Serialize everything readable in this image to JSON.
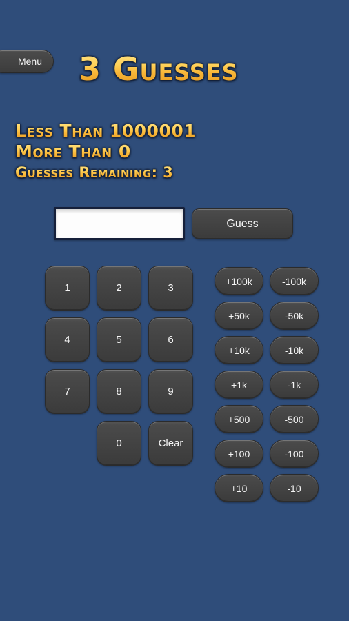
{
  "app": {
    "background_color": "#2F4D7A",
    "title": "3 Guesses"
  },
  "header": {
    "menu_label": "Menu",
    "title": "3 Guesses"
  },
  "status": {
    "less_than": "Less Than 1000001",
    "more_than": "More Than 0",
    "guesses_remaining": "Guesses Remaining: 3"
  },
  "guess_form": {
    "input_value": "",
    "input_placeholder": "",
    "submit_label": "Guess"
  },
  "keypad": {
    "keys": [
      {
        "label": "1",
        "name": "key-1"
      },
      {
        "label": "2",
        "name": "key-2"
      },
      {
        "label": "3",
        "name": "key-3"
      },
      {
        "label": "4",
        "name": "key-4"
      },
      {
        "label": "5",
        "name": "key-5"
      },
      {
        "label": "6",
        "name": "key-6"
      },
      {
        "label": "7",
        "name": "key-7"
      },
      {
        "label": "8",
        "name": "key-8"
      },
      {
        "label": "9",
        "name": "key-9"
      },
      {
        "label": "",
        "name": "key-blank"
      },
      {
        "label": "0",
        "name": "key-0"
      },
      {
        "label": "Clear",
        "name": "key-clear"
      }
    ]
  },
  "adjust_pad": {
    "rows": [
      {
        "increase": "+100k",
        "decrease": "-100k"
      },
      {
        "increase": "+50k",
        "decrease": "-50k"
      },
      {
        "increase": "+10k",
        "decrease": "-10k"
      },
      {
        "increase": "+1k",
        "decrease": "-1k"
      },
      {
        "increase": "+500",
        "decrease": "-500"
      },
      {
        "increase": "+100",
        "decrease": "-100"
      },
      {
        "increase": "+10",
        "decrease": "-10"
      }
    ]
  },
  "colors": {
    "background": "#2F4D7A",
    "button_face": "#434343",
    "button_text": "#F4F4F4",
    "gold_light": "#FFE489",
    "gold_dark": "#E4951C",
    "outline": "#14223C",
    "input_background": "#FDFDFD",
    "input_border": "#16203A"
  }
}
